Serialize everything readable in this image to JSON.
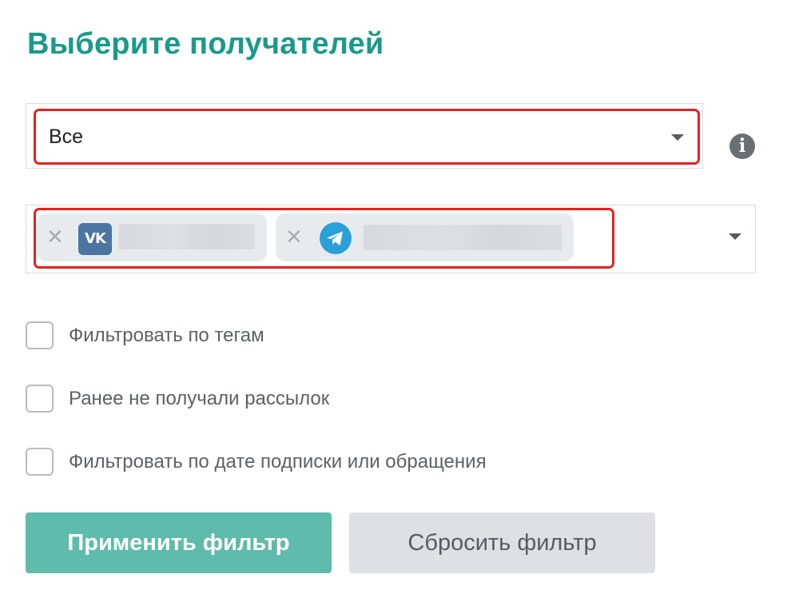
{
  "title": "Выберите получателей",
  "recipients_select": {
    "value": "Все"
  },
  "channels": {
    "chips": [
      {
        "type": "vk",
        "icon": "vk-icon",
        "icon_text": "VK"
      },
      {
        "type": "telegram",
        "icon": "telegram-icon"
      }
    ]
  },
  "checkboxes": [
    {
      "label": "Фильтровать по тегам",
      "checked": false
    },
    {
      "label": "Ранее не получали рассылок",
      "checked": false
    },
    {
      "label": "Фильтровать по дате подписки или обращения",
      "checked": false
    }
  ],
  "buttons": {
    "apply": "Применить фильтр",
    "reset": "Сбросить фильтр"
  },
  "colors": {
    "title": "#1a9a8a",
    "highlight": "#e5211f",
    "apply_bg": "#5fbbab",
    "reset_bg": "#dde1e5",
    "vk": "#4c75a3",
    "telegram": "#2a9fd8"
  }
}
